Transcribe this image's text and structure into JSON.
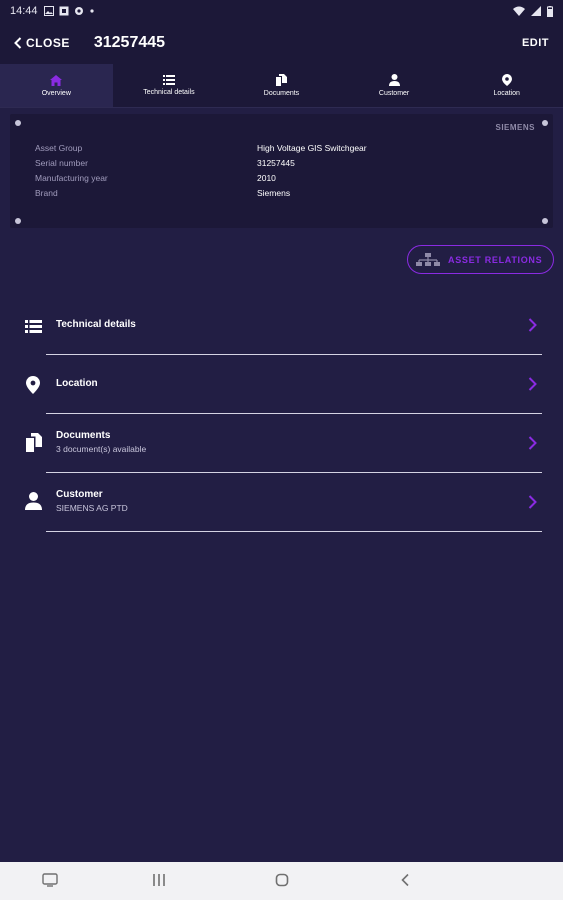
{
  "status_bar": {
    "time": "14:44",
    "left_icons": [
      "image-icon",
      "sim-icon",
      "settings-icon",
      "dot-icon"
    ],
    "right_icons": [
      "wifi-icon",
      "signal-icon",
      "battery-icon"
    ]
  },
  "app_bar": {
    "close_label": "CLOSE",
    "title": "31257445",
    "edit_label": "EDIT"
  },
  "tabs": [
    {
      "label": "Overview",
      "icon": "home-icon",
      "active": true
    },
    {
      "label": "Technical details",
      "icon": "list-icon",
      "active": false
    },
    {
      "label": "Documents",
      "icon": "documents-icon",
      "active": false
    },
    {
      "label": "Customer",
      "icon": "person-icon",
      "active": false
    },
    {
      "label": "Location",
      "icon": "location-pin-icon",
      "active": false
    }
  ],
  "asset_card": {
    "logo_text": "SIEMENS",
    "rows": [
      {
        "key": "Asset Group",
        "value": "High Voltage GIS Switchgear"
      },
      {
        "key": "Serial number",
        "value": "31257445"
      },
      {
        "key": "Manufacturing year",
        "value": "2010"
      },
      {
        "key": "Brand",
        "value": "Siemens"
      }
    ]
  },
  "asset_relations_label": "ASSET RELATIONS",
  "sections": [
    {
      "label": "Technical details",
      "subtitle": "",
      "icon": "list-icon"
    },
    {
      "label": "Location",
      "subtitle": "",
      "icon": "location-pin-icon"
    },
    {
      "label": "Documents",
      "subtitle": "3 document(s) available",
      "icon": "documents-icon"
    },
    {
      "label": "Customer",
      "subtitle": "SIEMENS AG PTD",
      "icon": "person-icon"
    }
  ],
  "colors": {
    "background": "#221e44",
    "header": "#1c1838",
    "accent": "#8a2be2",
    "active_tab": "#2a2650",
    "navbar": "#f2f2f4"
  }
}
